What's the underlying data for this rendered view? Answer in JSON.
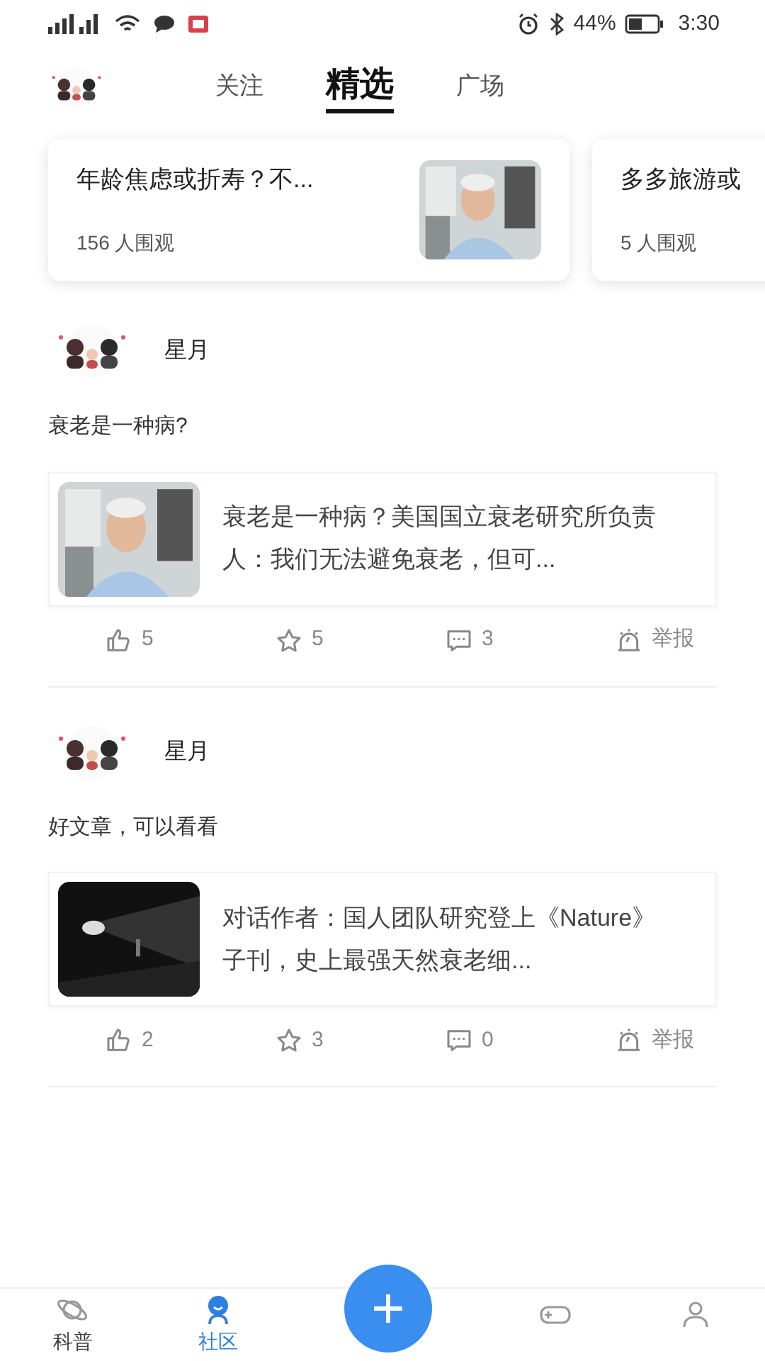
{
  "status_bar": {
    "battery": "44%",
    "time": "3:30"
  },
  "tabs": [
    {
      "label": "关注",
      "selected": false
    },
    {
      "label": "精选",
      "selected": true
    },
    {
      "label": "广场",
      "selected": false
    }
  ],
  "featured": [
    {
      "title": "年龄焦虑或折寿？不...",
      "viewers": "156 人围观"
    },
    {
      "title": "多多旅游或",
      "viewers": "5 人围观"
    }
  ],
  "posts": [
    {
      "author": "星月",
      "text": "衰老是一种病?",
      "article": {
        "title": "衰老是一种病？美国国立衰老研究所负责人：我们无法避免衰老，但可..."
      },
      "likes": "5",
      "favorites": "5",
      "comments": "3",
      "report": "举报"
    },
    {
      "author": "星月",
      "text": "好文章，可以看看",
      "article": {
        "title": "对话作者：国人团队研究登上《Nature》子刊，史上最强天然衰老细..."
      },
      "likes": "2",
      "favorites": "3",
      "comments": "0",
      "report": "举报"
    }
  ],
  "bottom_nav": [
    {
      "label": "科普",
      "kind": "science",
      "selected": false
    },
    {
      "label": "社区",
      "kind": "community",
      "selected": true
    },
    {
      "kind": "add"
    },
    {
      "kind": "game"
    },
    {
      "kind": "profile"
    }
  ]
}
